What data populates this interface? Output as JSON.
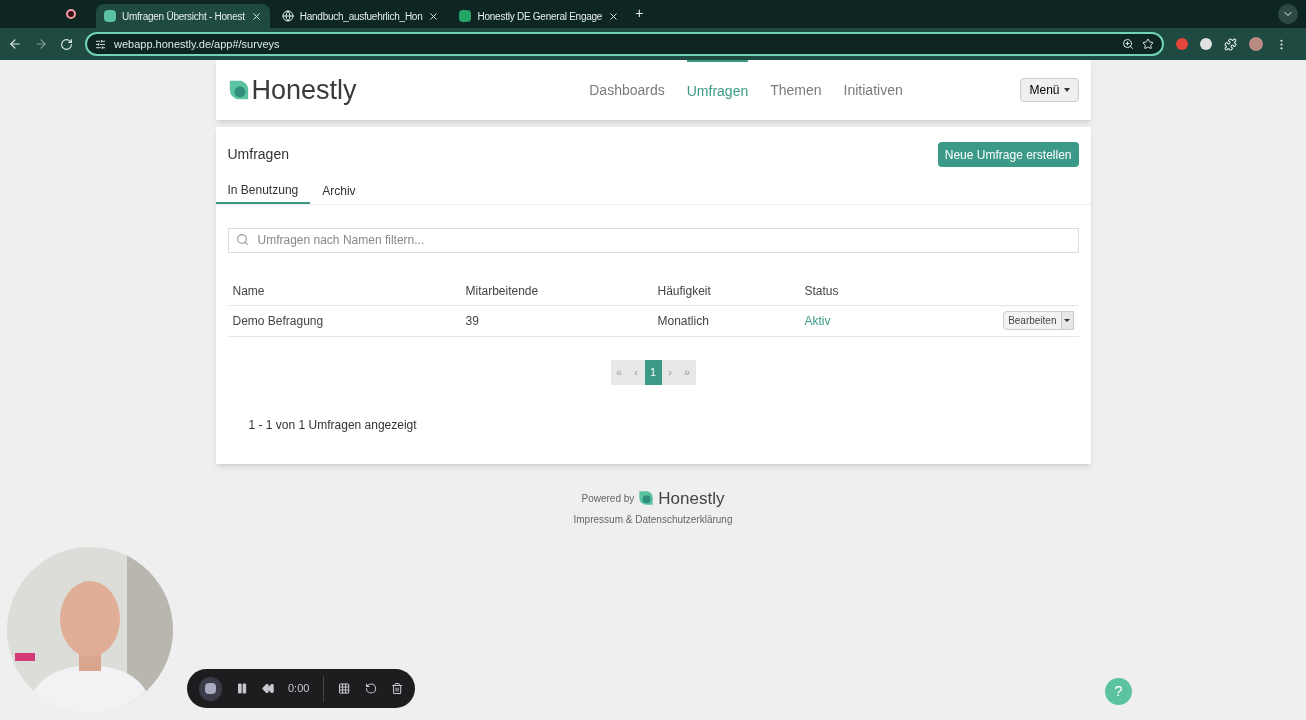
{
  "browser": {
    "tabs": [
      {
        "title": "Umfragen Übersicht - Honest",
        "selected": true,
        "kind": "app"
      },
      {
        "title": "Handbuch_ausfuehrlich_Hon",
        "selected": false,
        "kind": "globe"
      },
      {
        "title": "Honestly DE General Engage",
        "selected": false,
        "kind": "sheet"
      }
    ],
    "new_tab": "+",
    "url": "webapp.honestly.de/app#/surveys"
  },
  "header": {
    "logo": "Honestly",
    "nav": [
      {
        "label": "Dashboards",
        "selected": false
      },
      {
        "label": "Umfragen",
        "selected": true
      },
      {
        "label": "Themen",
        "selected": false
      },
      {
        "label": "Initiativen",
        "selected": false
      }
    ],
    "menu": "Menü"
  },
  "panel": {
    "title": "Umfragen",
    "create_button": "Neue Umfrage erstellen",
    "tabs": [
      {
        "label": "In Benutzung",
        "selected": true
      },
      {
        "label": "Archiv",
        "selected": false
      }
    ],
    "search": {
      "placeholder": "Umfragen nach Namen filtern..."
    },
    "table": {
      "columns": [
        "Name",
        "Mitarbeitende",
        "Häufigkeit",
        "Status"
      ],
      "rows": [
        {
          "name": "Demo Befragung",
          "employees": "39",
          "frequency": "Monatlich",
          "status": "Aktiv",
          "action": "Bearbeiten"
        }
      ]
    },
    "pagination": [
      {
        "label": "«",
        "selected": false
      },
      {
        "label": "‹",
        "selected": false
      },
      {
        "label": "1",
        "selected": true
      },
      {
        "label": "›",
        "selected": false
      },
      {
        "label": "»",
        "selected": false
      }
    ],
    "summary": "1 - 1 von 1 Umfragen angezeigt"
  },
  "footer": {
    "powered_by": "Powered by",
    "logo": "Honestly",
    "links": "Impressum & Datenschutzerklärung"
  },
  "recorder": {
    "time": "0:00"
  },
  "help": "?"
}
